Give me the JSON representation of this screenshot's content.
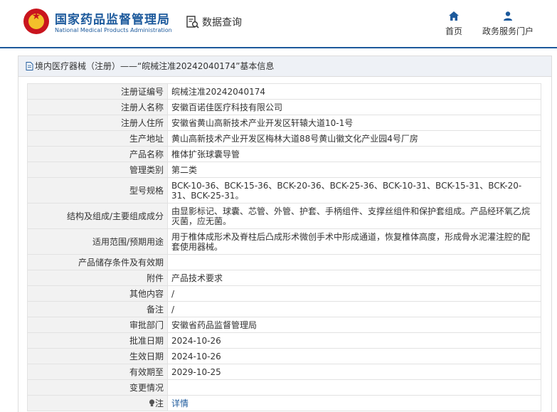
{
  "header": {
    "org_name_cn": "国家药品监督管理局",
    "org_name_en": "National Medical Products Administration",
    "section_title": "数据查询",
    "nav": {
      "home": "首页",
      "gov_services": "政务服务门户"
    }
  },
  "panel": {
    "breadcrumb": "境内医疗器械（注册）——“皖械注准20242040174”基本信息"
  },
  "details": {
    "rows": [
      {
        "label": "注册证编号",
        "value": "皖械注准20242040174"
      },
      {
        "label": "注册人名称",
        "value": "安徽百诺佳医疗科技有限公司"
      },
      {
        "label": "注册人住所",
        "value": "安徽省黄山高新技术产业开发区轩辕大道10-1号"
      },
      {
        "label": "生产地址",
        "value": "黄山高新技术产业开发区梅林大道88号黄山徽文化产业园4号厂房"
      },
      {
        "label": "产品名称",
        "value": "椎体扩张球囊导管"
      },
      {
        "label": "管理类别",
        "value": "第二类"
      },
      {
        "label": "型号规格",
        "value": "BCK-10-36、BCK-15-36、BCK-20-36、BCK-25-36、BCK-10-31、BCK-15-31、BCK-20-31、BCK-25-31。"
      },
      {
        "label": "结构及组成/主要组成成分",
        "value": "由显影标记、球囊、芯管、外管、护套、手柄组件、支撑丝组件和保护套组成。产品经环氧乙烷灭菌，应无菌。"
      },
      {
        "label": "适用范围/预期用途",
        "value": "用于椎体成形术及脊柱后凸成形术微创手术中形成通道，恢复椎体高度，形成骨水泥灌注腔的配套使用器械。"
      },
      {
        "label": "产品储存条件及有效期",
        "value": ""
      },
      {
        "label": "附件",
        "value": "产品技术要求"
      },
      {
        "label": "其他内容",
        "value": "/"
      },
      {
        "label": "备注",
        "value": "/"
      },
      {
        "label": "审批部门",
        "value": "安徽省药品监督管理局"
      },
      {
        "label": "批准日期",
        "value": "2024-10-26"
      },
      {
        "label": "生效日期",
        "value": "2024-10-26"
      },
      {
        "label": "有效期至",
        "value": "2029-10-25"
      },
      {
        "label": "变更情况",
        "value": ""
      },
      {
        "label": "注",
        "value": "详情"
      }
    ]
  },
  "colors": {
    "brand_blue": "#1d5a9c",
    "label_bg": "#f2f2f2",
    "logo_red": "#c9151e",
    "logo_gold": "#f3c02b"
  }
}
